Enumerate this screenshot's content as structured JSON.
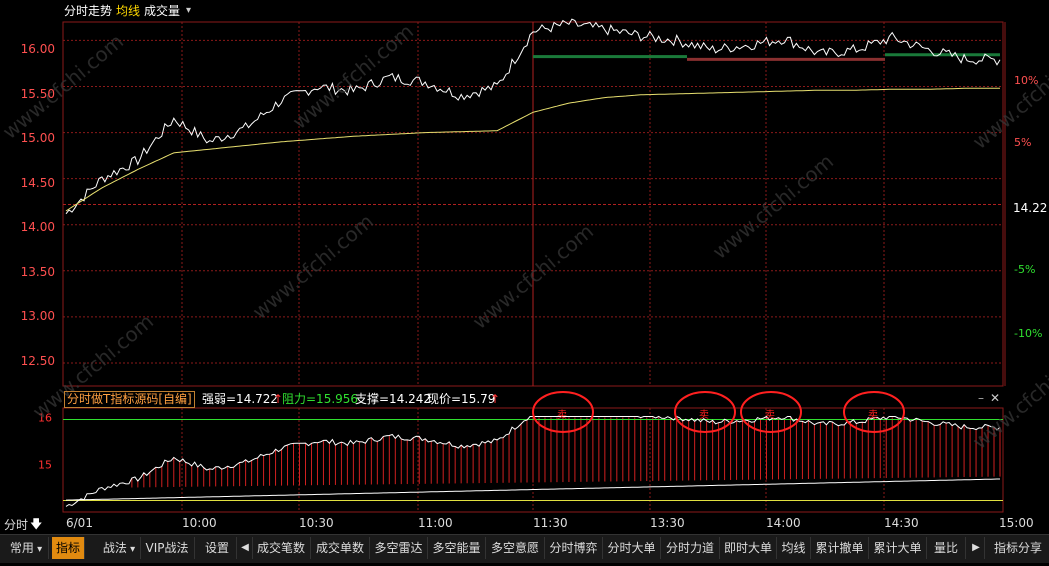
{
  "header": {
    "title": "分时走势",
    "ma_label": "均线",
    "vol_label": "成交量",
    "dropdown_glyph": "▾"
  },
  "main_y_ticks": [
    "16.00",
    "15.50",
    "15.00",
    "14.50",
    "14.00",
    "13.50",
    "13.00",
    "12.50"
  ],
  "pct_ticks": [
    {
      "label": "10%",
      "color": "#ff5050"
    },
    {
      "label": "5%",
      "color": "#ff5050"
    },
    {
      "label": "14.22",
      "color": "#ffffff"
    },
    {
      "label": "-5%",
      "color": "#30e030"
    },
    {
      "label": "-10%",
      "color": "#30e030"
    }
  ],
  "indicator": {
    "name": "分时做T指标源码[自编]",
    "strength": "强弱=14.722",
    "strength_arrow": "↑",
    "resistance": "阻力=15.956",
    "support": "支撑=14.242",
    "price": "现价=15.79",
    "price_arrow": "↑",
    "y_ticks": [
      "16",
      "15"
    ],
    "signals": [
      "卖",
      "卖",
      "卖",
      "卖"
    ]
  },
  "x_ticks": [
    "6/01",
    "10:00",
    "10:30",
    "11:00",
    "11:30",
    "13:30",
    "14:00",
    "14:30",
    "15:00"
  ],
  "period_label": "分时",
  "period_arrow": "🡇",
  "watermark": "www.cfchi.com",
  "toolbar": {
    "common": "常用",
    "indicator": "指标",
    "tactics": "战法",
    "vip": "VIP战法",
    "settings": "设置",
    "left_arrow": "◀",
    "right_arrow": "▶",
    "tabs": [
      "成交笔数",
      "成交单数",
      "多空雷达",
      "多空能量",
      "多空意愿",
      "分时博弈",
      "分时大单",
      "分时力道",
      "即时大单",
      "均线",
      "累计撤单",
      "累计大单",
      "量比"
    ],
    "share": "指标分享"
  },
  "colors": {
    "price": "#ffffff",
    "avg": "#e8e070",
    "grid": "#8b1a1a",
    "up": "#ff3030",
    "down": "#30e030",
    "signal": "#ff2020"
  },
  "chart_data": {
    "type": "line",
    "title": "",
    "xlabel": "",
    "ylabel": "",
    "ylim": [
      12.25,
      16.2
    ],
    "prev_close": 14.22,
    "series": [
      {
        "name": "",
        "x": [
          "09:30",
          "09:40",
          "09:50",
          "10:00",
          "10:10",
          "10:20",
          "10:30",
          "10:40",
          "10:50",
          "11:00",
          "11:10",
          "11:20",
          "11:30",
          "11:40",
          "11:50",
          "13:10",
          "13:20",
          "13:30",
          "13:40",
          "13:50",
          "14:00",
          "14:10",
          "14:20",
          "14:30",
          "14:40",
          "14:50",
          "15:00"
        ],
        "values": [
          14.12,
          14.5,
          14.7,
          15.15,
          14.9,
          15.05,
          15.35,
          15.5,
          15.45,
          15.6,
          15.55,
          15.4,
          15.5,
          16.1,
          16.18,
          16.12,
          16.05,
          16.0,
          15.9,
          15.95,
          16.02,
          15.85,
          15.9,
          16.03,
          15.9,
          15.8,
          15.79
        ]
      },
      {
        "name": "",
        "x": [
          "09:30",
          "09:40",
          "09:50",
          "10:00",
          "10:10",
          "10:20",
          "10:30",
          "10:40",
          "10:50",
          "11:00",
          "11:10",
          "11:20",
          "11:30",
          "11:40",
          "11:50",
          "13:10",
          "13:20",
          "13:30",
          "13:40",
          "13:50",
          "14:00",
          "14:10",
          "14:20",
          "14:30",
          "14:40",
          "14:50",
          "15:00"
        ],
        "values": [
          14.15,
          14.4,
          14.6,
          14.78,
          14.82,
          14.86,
          14.9,
          14.93,
          14.96,
          14.98,
          15.0,
          15.01,
          15.02,
          15.22,
          15.32,
          15.38,
          15.41,
          15.42,
          15.43,
          15.44,
          15.45,
          15.46,
          15.46,
          15.47,
          15.47,
          15.48,
          15.48
        ]
      }
    ],
    "indicator_levels": {
      "strength": 14.722,
      "resistance": 15.956,
      "support": 14.242,
      "price": 15.79
    }
  }
}
